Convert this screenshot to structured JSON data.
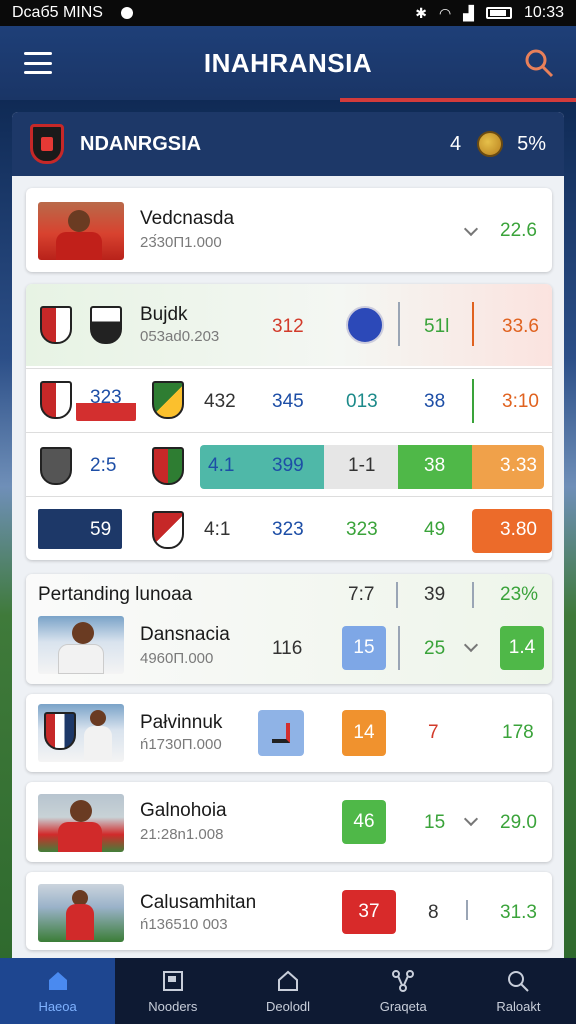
{
  "statusbar": {
    "left": "Dcaб5 MINS",
    "time": "10:33"
  },
  "appbar": {
    "title": "INAHRANSIA"
  },
  "panel": {
    "team": "NDANRGSIA",
    "num": "4",
    "pct": "5%"
  },
  "rows": [
    {
      "title": "Vedcnasda",
      "sub": "23́30П1.000",
      "value": "22.6"
    },
    {
      "title": "Bujdk",
      "sub": "053ad0.203",
      "v1": "312",
      "v2": "51l",
      "v3": "33.6"
    },
    {
      "s1": "323",
      "v1": "432",
      "v2": "345",
      "v3": "013",
      "v4": "38",
      "v5": "3:10"
    },
    {
      "s1": "2:5",
      "v1": "4.1",
      "v2": "399",
      "v3": "1-1",
      "v4": "38",
      "v5": "3.33"
    },
    {
      "s1": "59",
      "v1": "4:1",
      "v2": "323",
      "v3": "323",
      "v4": "49",
      "v5": "3.80"
    }
  ],
  "section": {
    "title": "Pertanding lunoaa",
    "v1": "7:7",
    "v2": "39",
    "v3": "23%"
  },
  "players": [
    {
      "title": "Dansnacia",
      "sub": "4960П.000",
      "v1": "116",
      "v2": "15",
      "v3": "25",
      "v4": "1.4"
    },
    {
      "title": "Pałvinnuk",
      "sub": "ń1730П.000",
      "v1": "14",
      "v2": "7",
      "v3": "178"
    },
    {
      "title": "Galnohoia",
      "sub": "21:28n1.008",
      "v1": "46",
      "v2": "15",
      "v3": "29.0"
    },
    {
      "title": "Calusamhitan",
      "sub": "ń136510 003",
      "v1": "37",
      "v2": "8",
      "v3": "31.3"
    }
  ],
  "nav": [
    {
      "label": "Haeoa"
    },
    {
      "label": "Nooders"
    },
    {
      "label": "Deolodl"
    },
    {
      "label": "Graqeta"
    },
    {
      "label": "Raloakt"
    }
  ]
}
